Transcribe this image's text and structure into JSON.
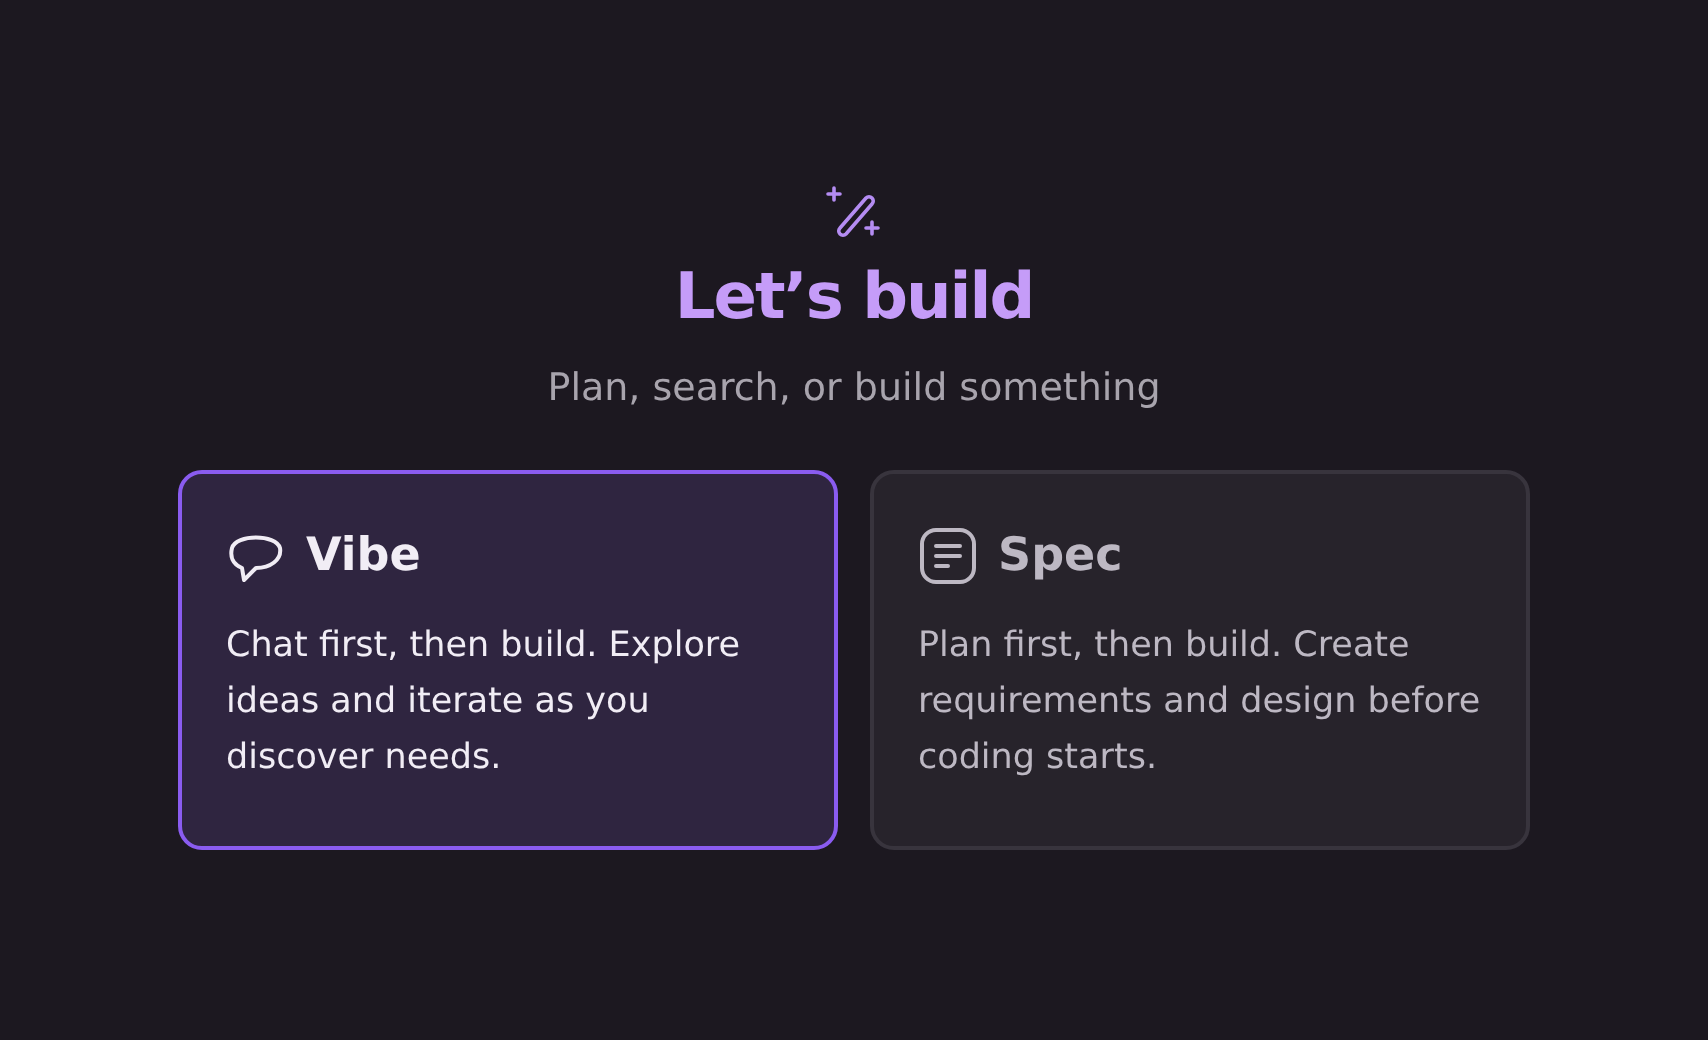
{
  "title": "Let’s build",
  "subtitle": "Plan, search, or build something",
  "modes": [
    {
      "kind": "chat",
      "title": "Vibe",
      "description": "Chat first, then build. Explore ideas and iterate as you discover needs.",
      "selected": true
    },
    {
      "kind": "spec",
      "title": "Spec",
      "description": "Plan first, then build. Create requirements and design before coding starts.",
      "selected": false
    }
  ]
}
